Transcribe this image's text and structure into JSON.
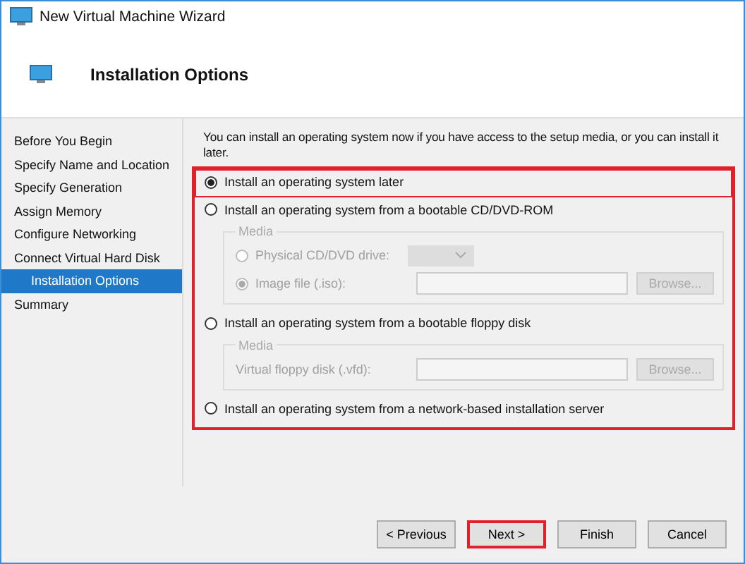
{
  "window": {
    "title": "New Virtual Machine Wizard"
  },
  "header": {
    "title": "Installation Options"
  },
  "steps": [
    {
      "label": "Before You Begin",
      "selected": false
    },
    {
      "label": "Specify Name and Location",
      "selected": false
    },
    {
      "label": "Specify Generation",
      "selected": false
    },
    {
      "label": "Assign Memory",
      "selected": false
    },
    {
      "label": "Configure Networking",
      "selected": false
    },
    {
      "label": "Connect Virtual Hard Disk",
      "selected": false
    },
    {
      "label": "Installation Options",
      "selected": true
    },
    {
      "label": "Summary",
      "selected": false
    }
  ],
  "intro": "You can install an operating system now if you have access to the setup media, or you can install it later.",
  "options_highlighted": true,
  "options": [
    {
      "label": "Install an operating system later",
      "selected": true,
      "highlighted": true
    },
    {
      "label": "Install an operating system from a bootable CD/DVD-ROM",
      "selected": false,
      "highlighted": false,
      "media": {
        "title": "Media",
        "rows": [
          {
            "kind": "radio_dropdown",
            "label": "Physical CD/DVD drive:",
            "selected": false
          },
          {
            "kind": "radio_file",
            "label": "Image file (.iso):",
            "selected": true,
            "button": "Browse..."
          }
        ]
      }
    },
    {
      "label": "Install an operating system from a bootable floppy disk",
      "selected": false,
      "highlighted": false,
      "media": {
        "title": "Media",
        "rows": [
          {
            "kind": "file",
            "label": "Virtual floppy disk (.vfd):",
            "button": "Browse..."
          }
        ]
      }
    },
    {
      "label": "Install an operating system from a network-based installation server",
      "selected": false,
      "highlighted": false
    }
  ],
  "buttons": [
    {
      "label": "< Previous",
      "highlighted": false
    },
    {
      "label": "Next >",
      "highlighted": true
    },
    {
      "label": "Finish",
      "highlighted": false
    },
    {
      "label": "Cancel",
      "highlighted": false
    }
  ]
}
